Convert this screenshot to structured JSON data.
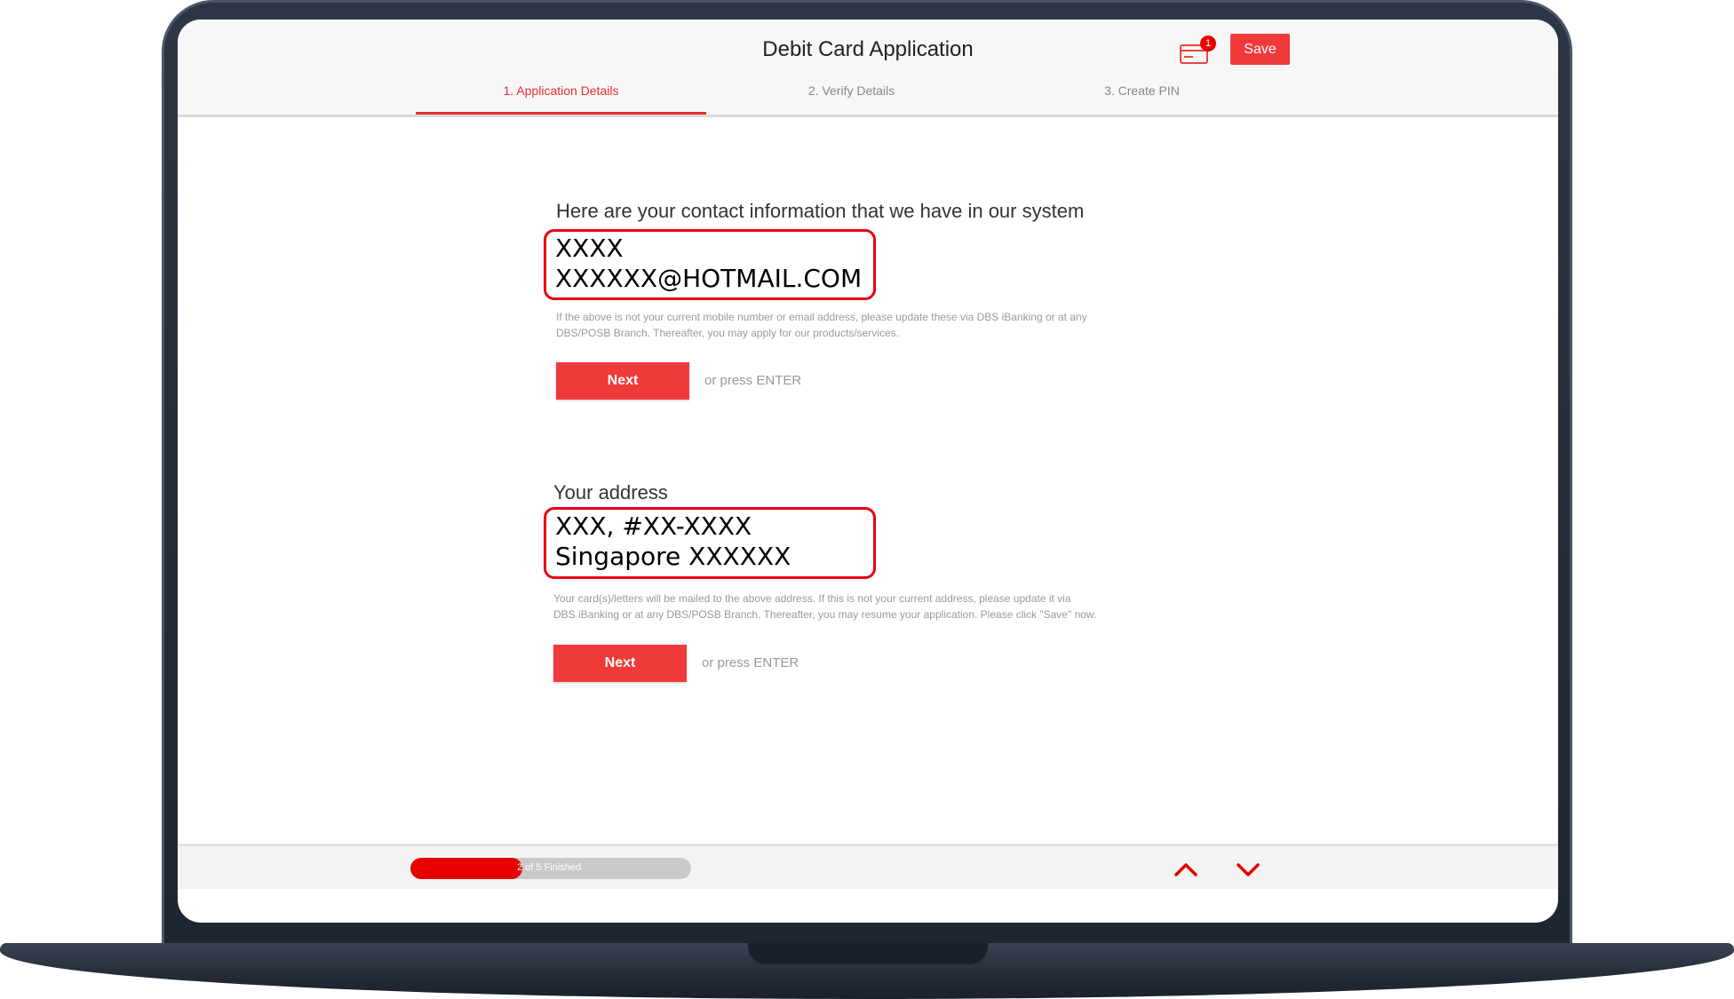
{
  "app": {
    "title": "Debit Card Application"
  },
  "header": {
    "save_label": "Save",
    "notification_count": "1",
    "accent_color": "#f03a3a"
  },
  "tabs": [
    {
      "label": "1.  Application Details",
      "active": true
    },
    {
      "label": "2.  Verify Details",
      "active": false
    },
    {
      "label": "3.  Create PIN",
      "active": false
    }
  ],
  "contact": {
    "heading": "Here are your contact information that we have in our system",
    "line1": "XXXX",
    "line2": "XXXXXX@HOTMAIL.COM",
    "help_line1": "If the above is not your current mobile number or email address, please update these via DBS iBanking or at any",
    "help_line2": "DBS/POSB Branch. Thereafter, you may apply for our products/services.",
    "next_label": "Next",
    "hint": "or press ENTER"
  },
  "address": {
    "heading": "Your address",
    "line1": "XXX, #XX-XXXX",
    "line2": "Singapore XXXXXX",
    "help_line1": "Your card(s)/letters will be mailed to the above address. If this is not your current address, please update it via",
    "help_line2": "DBS iBanking or at any DBS/POSB Branch. Thereafter, you may resume your application. Please click \"Save\" now.",
    "next_label": "Next",
    "hint": "or press ENTER"
  },
  "footer": {
    "progress_label": "2 of 5 Finished",
    "progress_fraction": 0.4,
    "up_icon": "chevron-up-icon",
    "down_icon": "chevron-down-icon"
  }
}
